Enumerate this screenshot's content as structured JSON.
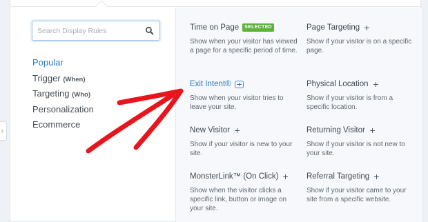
{
  "search": {
    "placeholder": "Search Display Rules"
  },
  "sidebar": {
    "items": [
      {
        "label": "Popular",
        "suffix": ""
      },
      {
        "label": "Trigger",
        "suffix": "(When)"
      },
      {
        "label": "Targeting",
        "suffix": "(Who)"
      },
      {
        "label": "Personalization",
        "suffix": ""
      },
      {
        "label": "Ecommerce",
        "suffix": ""
      }
    ]
  },
  "rules": [
    {
      "title": "Time on Page",
      "badge": "SELECTED",
      "desc": "Show when your visitor has viewed a page for a specific period of time."
    },
    {
      "title": "Page Targeting",
      "desc": "Show if your visitor is on a specific page."
    },
    {
      "title": "Exit Intent®",
      "desc": "Show when your visitor tries to leave your site."
    },
    {
      "title": "Physical Location",
      "desc": "Show if your visitor is from a specific location."
    },
    {
      "title": "New Visitor",
      "desc": "Show if your visitor is new to your site."
    },
    {
      "title": "Returning Visitor",
      "desc": "Show if your visitor is not new to your site."
    },
    {
      "title": "MonsterLink™ (On Click)",
      "desc": "Show when the visitor clicks a specific link, button or image on your site."
    },
    {
      "title": "Referral Targeting",
      "desc": "Show if your visitor came to your site from a specific website."
    }
  ],
  "left_tab": {
    "glyph": "‹"
  },
  "colors": {
    "accent": "#2f78c3",
    "selected_badge": "#5bb338",
    "arrow": "#e8151c"
  }
}
